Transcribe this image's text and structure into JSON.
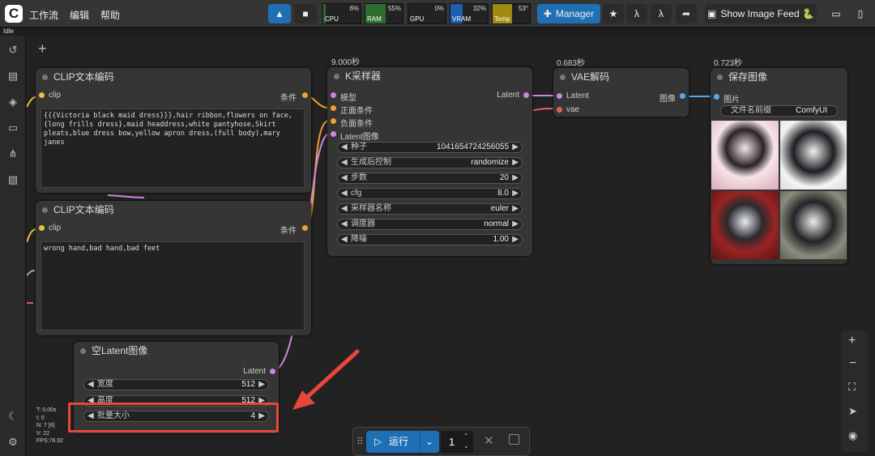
{
  "topbar": {
    "menu": [
      "工作流",
      "编辑",
      "帮助"
    ],
    "manager": "Manager",
    "show_feed": "Show Image Feed 🐍",
    "monitors": [
      {
        "label": "CPU",
        "pct": "6%",
        "value": 6,
        "color": "#2e6e2e"
      },
      {
        "label": "RAM",
        "pct": "55%",
        "value": 55,
        "color": "#2e6e2e"
      },
      {
        "label": "GPU",
        "pct": "0%",
        "value": 0,
        "color": "#2e6e2e"
      },
      {
        "label": "VRAM",
        "pct": "32%",
        "value": 32,
        "color": "#1f5fb0"
      },
      {
        "label": "Temp",
        "pct": "53°",
        "value": 53,
        "color": "#a08a10"
      }
    ],
    "colors": {
      "manager": "#1f6fb5",
      "accent": "#1f6fb5"
    }
  },
  "status": "Idle",
  "sidebar": {
    "icons": [
      "history-icon",
      "file-icon",
      "cube-icon",
      "folder-icon",
      "graph-icon",
      "image-icon",
      "moon-icon",
      "gear-icon"
    ]
  },
  "nodes": {
    "clip1": {
      "title": "CLIP文本编码",
      "in": "clip",
      "out": "条件",
      "text": "{{{Victoria black maid dress}}},hair ribbon,flowers on face,{long frills dress},maid headdress,white pantyhose,Skirt pleats,blue dress bow,yellow apron dress,(full body),mary janes"
    },
    "clip2": {
      "title": "CLIP文本编码",
      "in": "clip",
      "out": "条件",
      "text": "wrong hand,bad hand,bad feet"
    },
    "ksampler": {
      "title": "K采样器",
      "time": "9.000秒",
      "inputs": [
        "模型",
        "正面条件",
        "负面条件",
        "Latent图像"
      ],
      "out": "Latent",
      "widgets": [
        {
          "name": "种子",
          "value": "1041654724256055"
        },
        {
          "name": "生成后控制",
          "value": "randomize"
        },
        {
          "name": "步数",
          "value": "20"
        },
        {
          "name": "cfg",
          "value": "8.0"
        },
        {
          "name": "采样器名称",
          "value": "euler"
        },
        {
          "name": "调度器",
          "value": "normal"
        },
        {
          "name": "降噪",
          "value": "1.00"
        }
      ]
    },
    "vae": {
      "title": "VAE解码",
      "time": "0.683秒",
      "inputs": [
        "Latent",
        "vae"
      ],
      "out": "图像"
    },
    "save": {
      "title": "保存图像",
      "time": "0.723秒",
      "in": "图片",
      "prefix_name": "文件名前缀",
      "prefix_value": "ComfyUI"
    },
    "latent": {
      "title": "空Latent图像",
      "out": "Latent",
      "widgets": [
        {
          "name": "宽度",
          "value": "512"
        },
        {
          "name": "高度",
          "value": "512"
        },
        {
          "name": "批量大小",
          "value": "4"
        }
      ]
    }
  },
  "stats": [
    "T: 0.00s",
    "I: 0",
    "N: 7 [6]",
    "V: 22",
    "FPS:76.92"
  ],
  "run": {
    "label": "运行",
    "count": "1"
  }
}
